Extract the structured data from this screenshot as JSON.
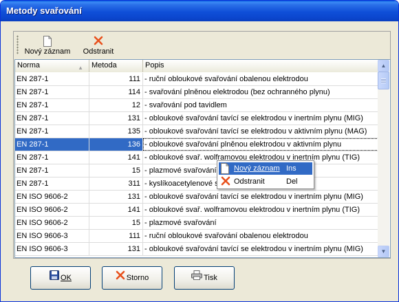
{
  "window": {
    "title": "Metody svařování"
  },
  "toolbar": {
    "new_label": "Nový záznam",
    "delete_label": "Odstranit"
  },
  "columns": [
    "Norma",
    "Metoda",
    "Popis"
  ],
  "rows": [
    {
      "norma": "EN 287-1",
      "metoda": "111",
      "popis": "- ruční obloukové svařování obalenou elektrodou"
    },
    {
      "norma": "EN 287-1",
      "metoda": "114",
      "popis": "- svařování plněnou elektrodou (bez ochranného plynu)"
    },
    {
      "norma": "EN 287-1",
      "metoda": "12",
      "popis": "- svařování pod tavidlem"
    },
    {
      "norma": "EN 287-1",
      "metoda": "131",
      "popis": "- obloukové svařování tavící se elektrodou v inertním plynu (MIG)"
    },
    {
      "norma": "EN 287-1",
      "metoda": "135",
      "popis": "- obloukové svařování tavící se elektrodou v aktivním plynu (MAG)"
    },
    {
      "norma": "EN 287-1",
      "metoda": "136",
      "popis": "- obloukové svařování plněnou elektrodou v aktivním plynu"
    },
    {
      "norma": "EN 287-1",
      "metoda": "141",
      "popis": "- obloukové svař. wolframovou elektrodou v inertním plynu (TIG)"
    },
    {
      "norma": "EN 287-1",
      "metoda": "15",
      "popis": "- plazmové svařování"
    },
    {
      "norma": "EN 287-1",
      "metoda": "311",
      "popis": "- kyslíkoacetylenové svařování"
    },
    {
      "norma": "EN ISO 9606-2",
      "metoda": "131",
      "popis": "- obloukové svařování tavící se elektrodou v inertním plynu (MIG)"
    },
    {
      "norma": "EN ISO 9606-2",
      "metoda": "141",
      "popis": "- obloukové svař. wolframovou elektrodou v inertním plynu (TIG)"
    },
    {
      "norma": "EN ISO 9606-2",
      "metoda": "15",
      "popis": "- plazmové svařování"
    },
    {
      "norma": "EN ISO 9606-3",
      "metoda": "111",
      "popis": "- ruční obloukové svařování obalenou elektrodou"
    },
    {
      "norma": "EN ISO 9606-3",
      "metoda": "131",
      "popis": "- obloukové svařování tavící se elektrodou v inertním plynu (MIG)"
    }
  ],
  "selected_row": 5,
  "context_menu": [
    {
      "label": "Nový záznam",
      "shortcut": "Ins"
    },
    {
      "label": "Odstranit",
      "shortcut": "Del"
    }
  ],
  "buttons": {
    "ok": "OK",
    "cancel": "Storno",
    "print": "Tisk"
  },
  "colors": {
    "selection": "#316ac5",
    "title_bar": "#0b47cf",
    "delete_icon": "#e8501c"
  }
}
